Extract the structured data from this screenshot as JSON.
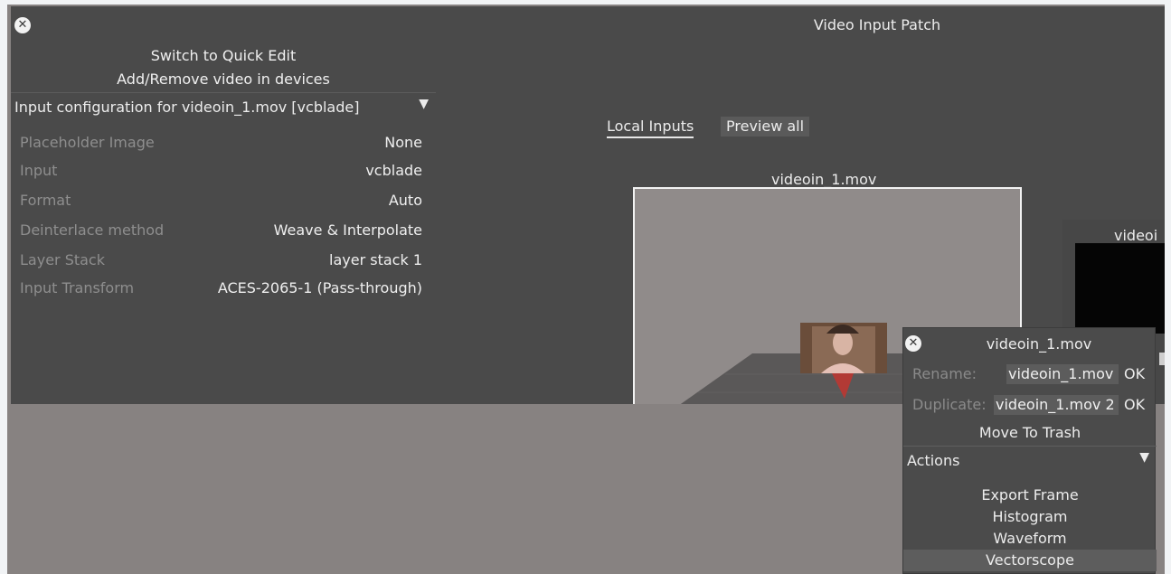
{
  "window": {
    "title": "Video Input Patch"
  },
  "menu": {
    "quick_edit": "Switch to Quick Edit",
    "add_remove": "Add/Remove video in devices"
  },
  "config": {
    "header": "Input configuration for videoin_1.mov [vcblade]",
    "rows": [
      {
        "key": "Placeholder Image",
        "value": "None"
      },
      {
        "key": "Input",
        "value": "vcblade"
      },
      {
        "key": "Format",
        "value": "Auto"
      },
      {
        "key": "Deinterlace method",
        "value": "Weave & Interpolate"
      },
      {
        "key": "Layer Stack",
        "value": "layer stack 1"
      },
      {
        "key": "Input Transform",
        "value": "ACES-2065-1 (Pass-through)"
      }
    ]
  },
  "tabs": {
    "local": "Local Inputs",
    "preview": "Preview all"
  },
  "thumbnails": {
    "first": "videoin_1.mov",
    "second_partial": "videoi"
  },
  "context": {
    "title": "videoin_1.mov",
    "rename_label": "Rename:",
    "rename_value": "videoin_1.mov",
    "duplicate_label": "Duplicate:",
    "duplicate_value": "videoin_1.mov 2",
    "ok": "OK",
    "trash": "Move To Trash",
    "actions_label": "Actions",
    "actions": [
      "Export Frame",
      "Histogram",
      "Waveform",
      "Vectorscope"
    ]
  },
  "icons": {
    "close": "close-icon",
    "dropdown": "triangle-down-icon"
  },
  "colors": {
    "panel": "#4a4a4a",
    "stage": "#878281",
    "highlight": "#5d5d5d"
  }
}
